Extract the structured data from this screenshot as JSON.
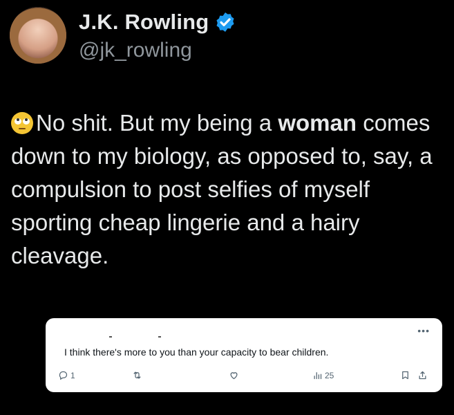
{
  "profile": {
    "display_name": "J.K. Rowling",
    "handle": "@jk_rowling",
    "verified_color": "#1d9bf0"
  },
  "tweet": {
    "emoji": "face-with-rolling-eyes",
    "text_before_bold": "No shit. But my being a ",
    "bold": "woman",
    "text_after_bold": " comes down to my biology, as opposed to, say, a compulsion to post selfies of myself sporting cheap lingerie and a hairy cleavage."
  },
  "quoted_tweet": {
    "text": "I think there's more to you than your capacity to bear children.",
    "more_icon": "more-dots-icon",
    "replies": "1",
    "views": "25"
  }
}
